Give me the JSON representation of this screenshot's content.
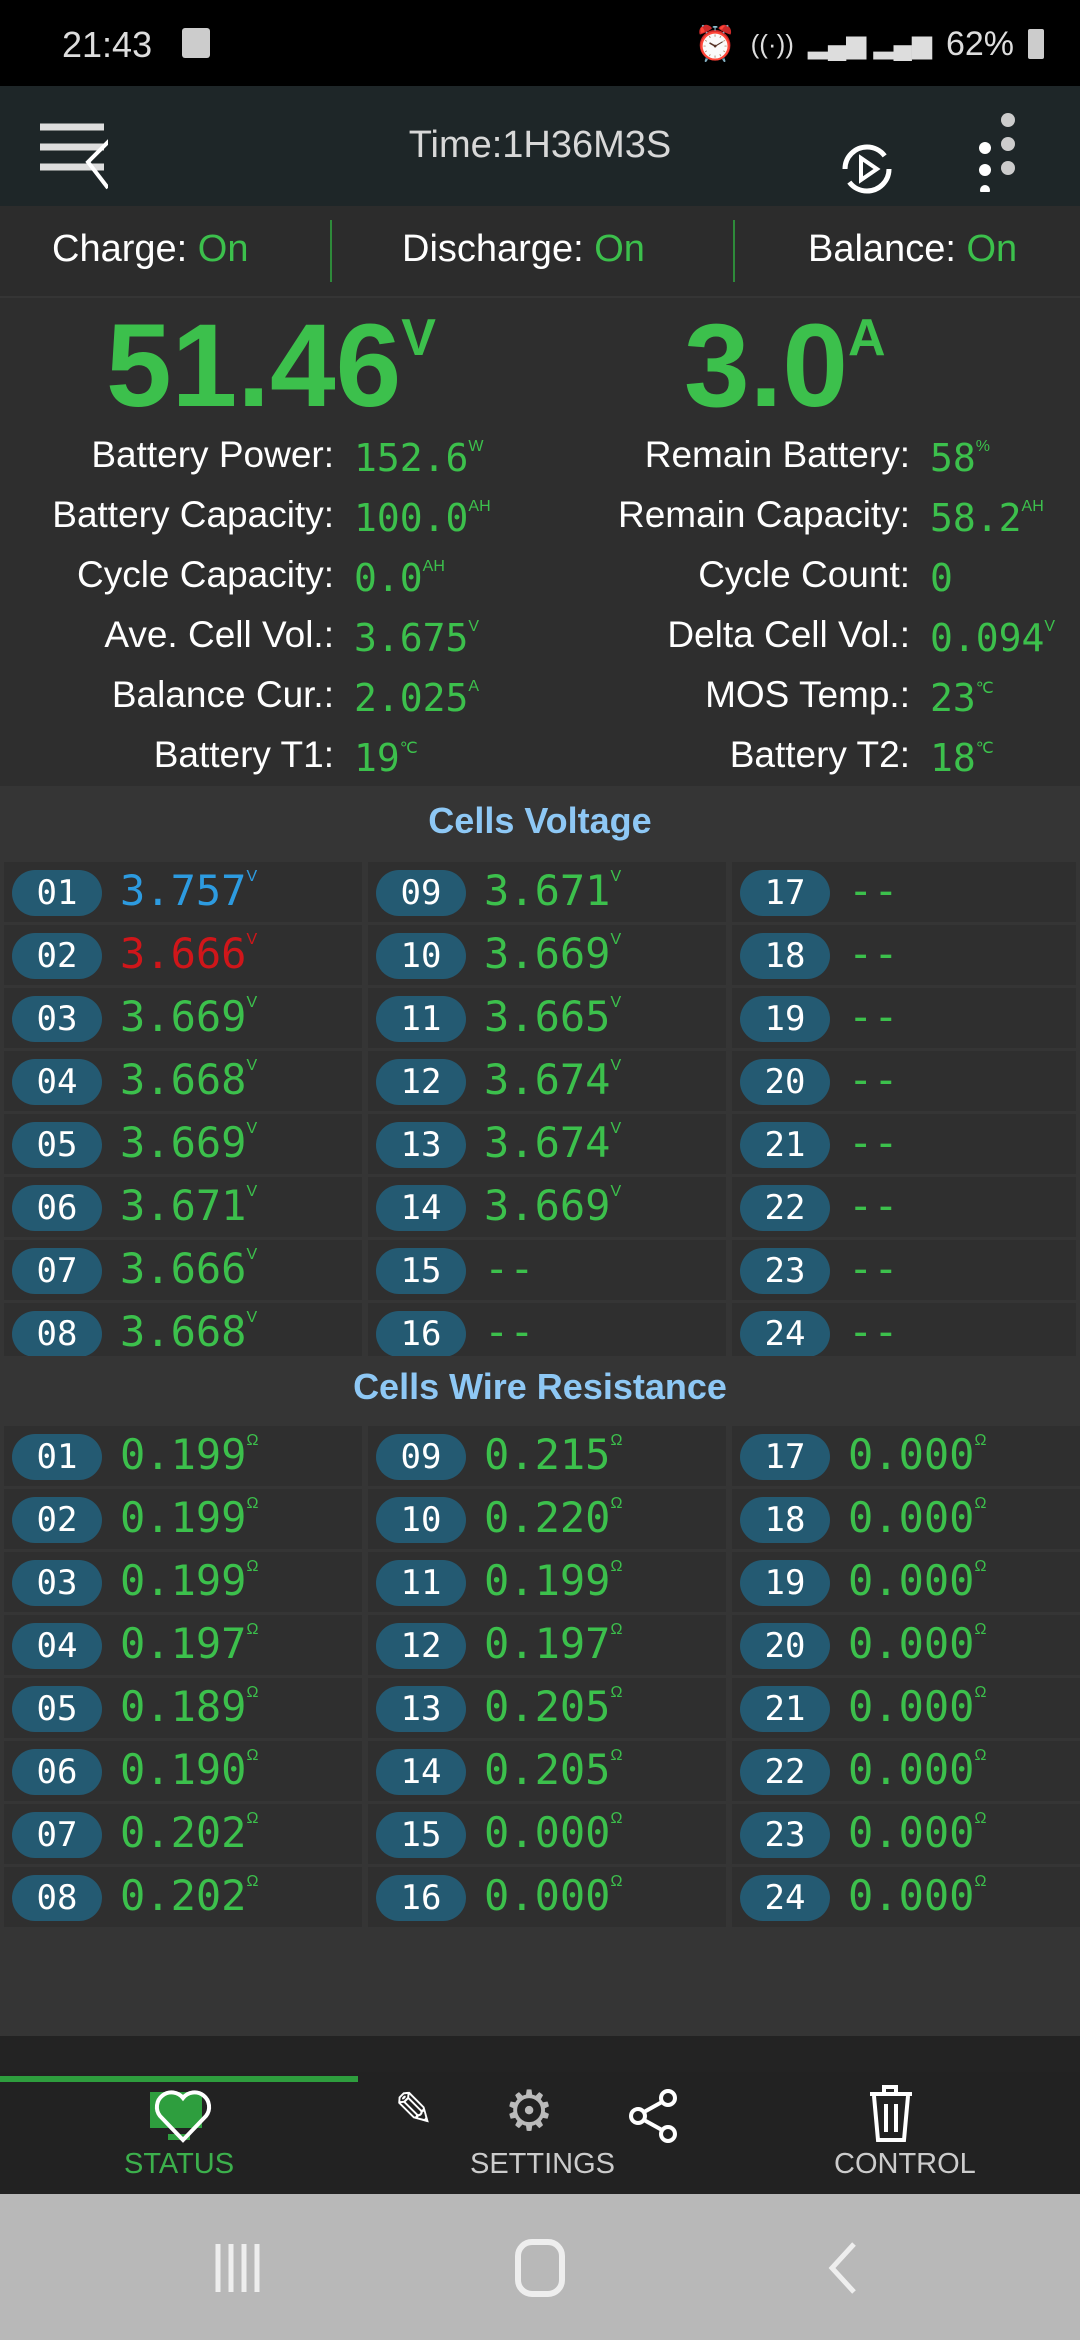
{
  "status_bar": {
    "time": "21:43",
    "battery": "62%",
    "icons": [
      "image-icon",
      "alarm-icon",
      "wifi-icon",
      "volte-icon",
      "signal-icon",
      "battery-icon"
    ]
  },
  "app_bar": {
    "title": "Time:1H36M3S",
    "icons": [
      "menu-back-icon",
      "replay-icon",
      "more-vert-icon"
    ]
  },
  "toggles": [
    {
      "label": "Charge:",
      "state": "On"
    },
    {
      "label": "Discharge:",
      "state": "On"
    },
    {
      "label": "Balance:",
      "state": "On"
    }
  ],
  "summary": {
    "voltage": {
      "value": "51.46",
      "unit": "V"
    },
    "current": {
      "value": "3.0",
      "unit": "A"
    },
    "left": [
      {
        "label": "Battery Power:",
        "value": "152.6",
        "unit": "W"
      },
      {
        "label": "Battery Capacity:",
        "value": "100.0",
        "unit": "AH"
      },
      {
        "label": "Cycle Capacity:",
        "value": "0.0",
        "unit": "AH"
      },
      {
        "label": "Ave. Cell Vol.:",
        "value": "3.675",
        "unit": "V"
      },
      {
        "label": "Balance Cur.:",
        "value": "2.025",
        "unit": "A"
      },
      {
        "label": "Battery T1:",
        "value": "19",
        "unit": "℃"
      }
    ],
    "right": [
      {
        "label": "Remain Battery:",
        "value": "58",
        "unit": "%"
      },
      {
        "label": "Remain Capacity:",
        "value": "58.2",
        "unit": "AH"
      },
      {
        "label": "Cycle Count:",
        "value": "0",
        "unit": ""
      },
      {
        "label": "Delta Cell Vol.:",
        "value": "0.094",
        "unit": "V"
      },
      {
        "label": "MOS Temp.:",
        "value": "23",
        "unit": "℃"
      },
      {
        "label": "Battery T2:",
        "value": "18",
        "unit": "℃"
      }
    ]
  },
  "colors": {
    "normal": "#3cc04c",
    "max": "#2d9be0",
    "min": "#d0161a",
    "title": "#8ec8f5"
  },
  "cells_voltage": {
    "title": "Cells Voltage",
    "cells": [
      {
        "id": "01",
        "value": "3.757",
        "unit": "V",
        "state": "max"
      },
      {
        "id": "02",
        "value": "3.666",
        "unit": "V",
        "state": "min"
      },
      {
        "id": "03",
        "value": "3.669",
        "unit": "V",
        "state": "normal"
      },
      {
        "id": "04",
        "value": "3.668",
        "unit": "V",
        "state": "normal"
      },
      {
        "id": "05",
        "value": "3.669",
        "unit": "V",
        "state": "normal"
      },
      {
        "id": "06",
        "value": "3.671",
        "unit": "V",
        "state": "normal"
      },
      {
        "id": "07",
        "value": "3.666",
        "unit": "V",
        "state": "normal"
      },
      {
        "id": "08",
        "value": "3.668",
        "unit": "V",
        "state": "normal"
      },
      {
        "id": "09",
        "value": "3.671",
        "unit": "V",
        "state": "normal"
      },
      {
        "id": "10",
        "value": "3.669",
        "unit": "V",
        "state": "normal"
      },
      {
        "id": "11",
        "value": "3.665",
        "unit": "V",
        "state": "normal"
      },
      {
        "id": "12",
        "value": "3.674",
        "unit": "V",
        "state": "normal"
      },
      {
        "id": "13",
        "value": "3.674",
        "unit": "V",
        "state": "normal"
      },
      {
        "id": "14",
        "value": "3.669",
        "unit": "V",
        "state": "normal"
      },
      {
        "id": "15",
        "value": "--",
        "unit": "",
        "state": "normal"
      },
      {
        "id": "16",
        "value": "--",
        "unit": "",
        "state": "normal"
      },
      {
        "id": "17",
        "value": "--",
        "unit": "",
        "state": "normal"
      },
      {
        "id": "18",
        "value": "--",
        "unit": "",
        "state": "normal"
      },
      {
        "id": "19",
        "value": "--",
        "unit": "",
        "state": "normal"
      },
      {
        "id": "20",
        "value": "--",
        "unit": "",
        "state": "normal"
      },
      {
        "id": "21",
        "value": "--",
        "unit": "",
        "state": "normal"
      },
      {
        "id": "22",
        "value": "--",
        "unit": "",
        "state": "normal"
      },
      {
        "id": "23",
        "value": "--",
        "unit": "",
        "state": "normal"
      },
      {
        "id": "24",
        "value": "--",
        "unit": "",
        "state": "normal"
      }
    ]
  },
  "cells_resistance": {
    "title": "Cells Wire Resistance",
    "cells": [
      {
        "id": "01",
        "value": "0.199",
        "unit": "Ω"
      },
      {
        "id": "02",
        "value": "0.199",
        "unit": "Ω"
      },
      {
        "id": "03",
        "value": "0.199",
        "unit": "Ω"
      },
      {
        "id": "04",
        "value": "0.197",
        "unit": "Ω"
      },
      {
        "id": "05",
        "value": "0.189",
        "unit": "Ω"
      },
      {
        "id": "06",
        "value": "0.190",
        "unit": "Ω"
      },
      {
        "id": "07",
        "value": "0.202",
        "unit": "Ω"
      },
      {
        "id": "08",
        "value": "0.202",
        "unit": "Ω"
      },
      {
        "id": "09",
        "value": "0.215",
        "unit": "Ω"
      },
      {
        "id": "10",
        "value": "0.220",
        "unit": "Ω"
      },
      {
        "id": "11",
        "value": "0.199",
        "unit": "Ω"
      },
      {
        "id": "12",
        "value": "0.197",
        "unit": "Ω"
      },
      {
        "id": "13",
        "value": "0.205",
        "unit": "Ω"
      },
      {
        "id": "14",
        "value": "0.205",
        "unit": "Ω"
      },
      {
        "id": "15",
        "value": "0.000",
        "unit": "Ω"
      },
      {
        "id": "16",
        "value": "0.000",
        "unit": "Ω"
      },
      {
        "id": "17",
        "value": "0.000",
        "unit": "Ω"
      },
      {
        "id": "18",
        "value": "0.000",
        "unit": "Ω"
      },
      {
        "id": "19",
        "value": "0.000",
        "unit": "Ω"
      },
      {
        "id": "20",
        "value": "0.000",
        "unit": "Ω"
      },
      {
        "id": "21",
        "value": "0.000",
        "unit": "Ω"
      },
      {
        "id": "22",
        "value": "0.000",
        "unit": "Ω"
      },
      {
        "id": "23",
        "value": "0.000",
        "unit": "Ω"
      },
      {
        "id": "24",
        "value": "0.000",
        "unit": "Ω"
      }
    ]
  },
  "bottom_nav": {
    "tabs": [
      {
        "label": "STATUS",
        "active": true
      },
      {
        "label": "SETTINGS",
        "active": false
      },
      {
        "label": "CONTROL",
        "active": false
      }
    ]
  }
}
